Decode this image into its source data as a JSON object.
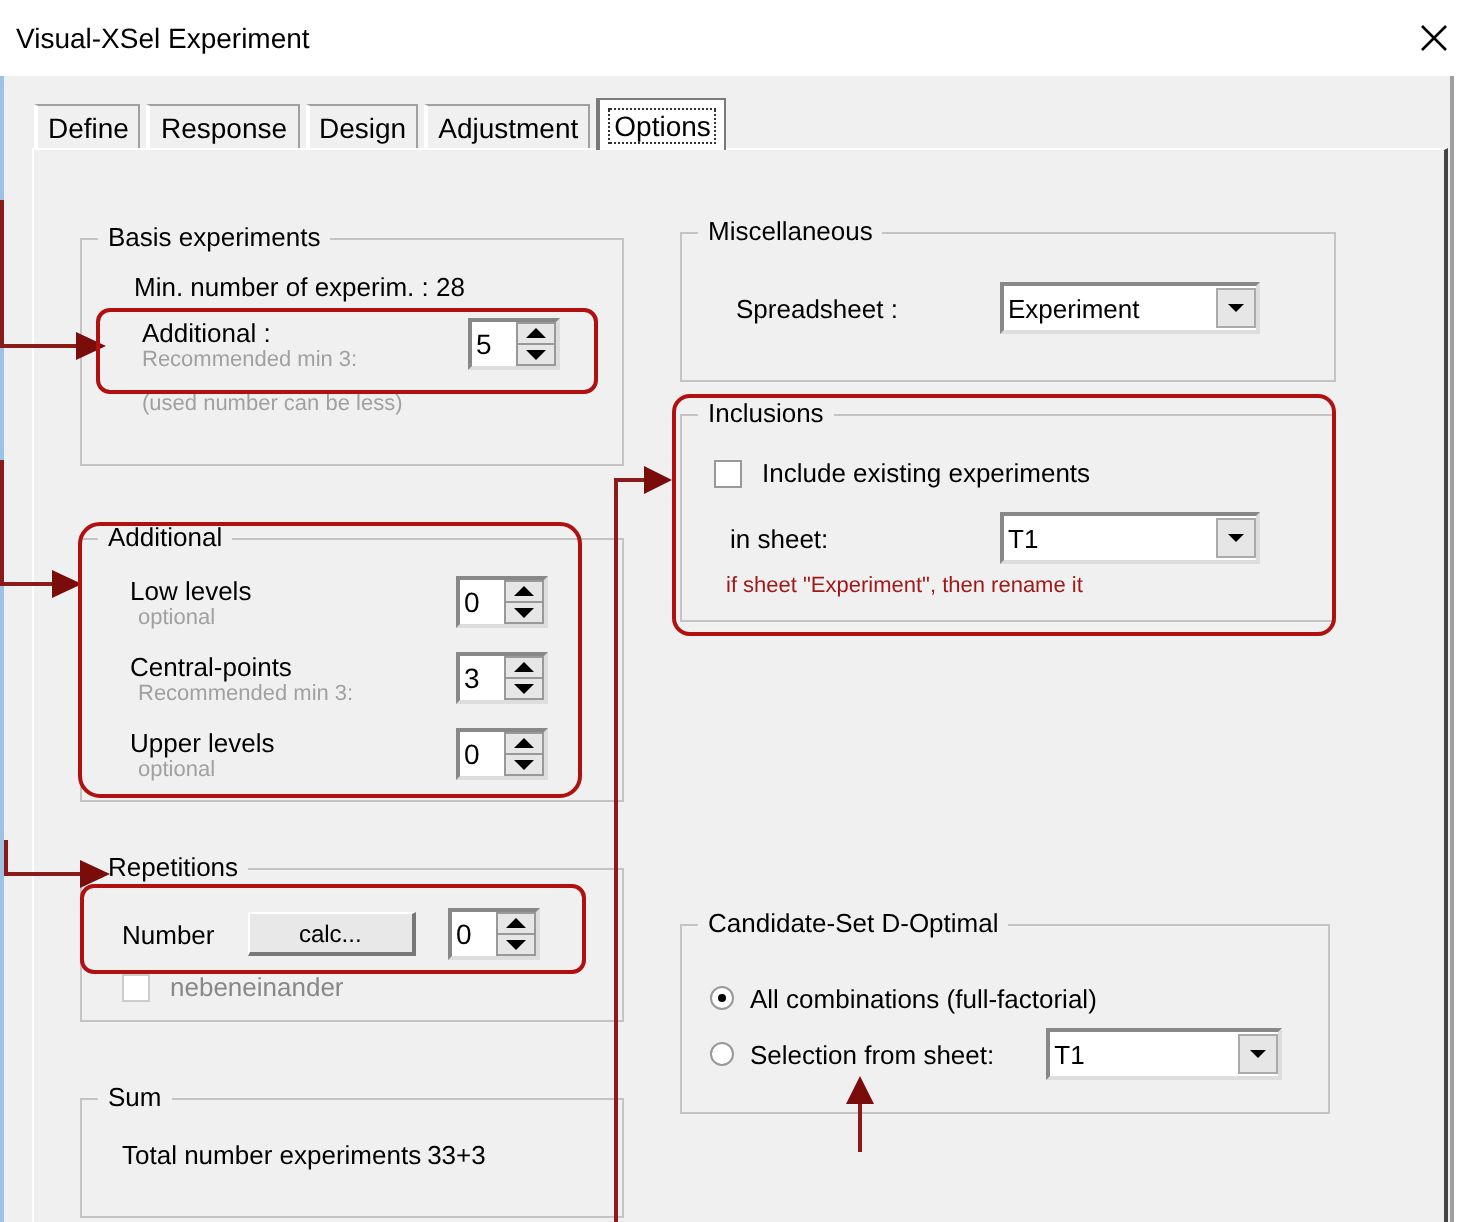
{
  "window": {
    "title": "Visual-XSel  Experiment"
  },
  "tabs": [
    {
      "label": "Define",
      "selected": false
    },
    {
      "label": "Response",
      "selected": false
    },
    {
      "label": "Design",
      "selected": false
    },
    {
      "label": "Adjustment",
      "selected": false
    },
    {
      "label": "Options",
      "selected": true
    }
  ],
  "basis": {
    "title": "Basis experiments",
    "min_text": "Min. number of experim. : 28",
    "additional": {
      "label": "Additional :",
      "hint": "Recommended min 3:",
      "value": "5"
    },
    "note": "(used number can be less)"
  },
  "additional": {
    "title": "Additional",
    "rows": [
      {
        "label": "Low levels",
        "hint": "optional",
        "value": "0"
      },
      {
        "label": "Central-points",
        "hint": "Recommended min 3:",
        "value": "3"
      },
      {
        "label": "Upper levels",
        "hint": "optional",
        "value": "0"
      }
    ]
  },
  "repetitions": {
    "title": "Repetitions",
    "label": "Number",
    "button": "calc...",
    "value": "0",
    "checkbox": {
      "label": "nebeneinander",
      "checked": false,
      "disabled": true
    }
  },
  "sum": {
    "title": "Sum",
    "label": "Total number experiments",
    "value": "33+3"
  },
  "miscellaneous": {
    "title": "Miscellaneous",
    "label": "Spreadsheet :",
    "value": "Experiment"
  },
  "inclusions": {
    "title": "Inclusions",
    "checkbox": {
      "label": "Include existing experiments",
      "checked": false,
      "disabled": false
    },
    "sheet_label": "in sheet:",
    "sheet_value": "T1",
    "note": "if sheet \"Experiment\", then rename it"
  },
  "candidate_set": {
    "title": "Candidate-Set D-Optimal",
    "options": [
      {
        "label": "All combinations (full-factorial)",
        "selected": true
      },
      {
        "label": "Selection from sheet:",
        "selected": false
      }
    ],
    "sheet_value": "T1"
  }
}
